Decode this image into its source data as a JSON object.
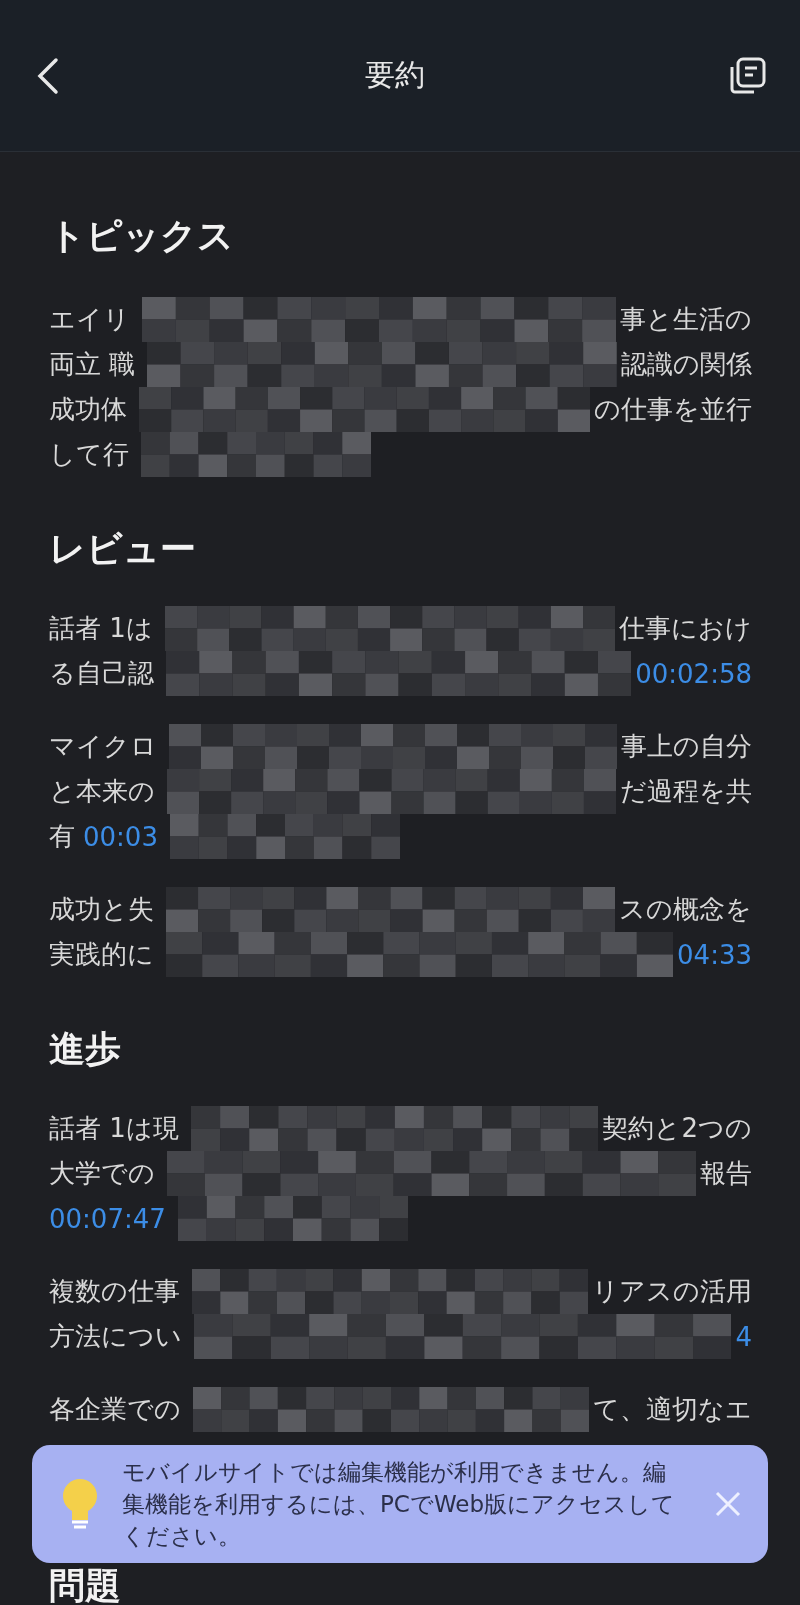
{
  "header": {
    "title": "要約"
  },
  "sections": [
    {
      "title": "トピックス",
      "paragraphs": [
        {
          "lines": [
            {
              "left": [
                {
                  "kind": "text",
                  "text": "エイリ"
                }
              ],
              "right": [
                {
                  "kind": "text",
                  "text": "事と生活の"
                }
              ]
            },
            {
              "left": [
                {
                  "kind": "text",
                  "text": "両立 職"
                }
              ],
              "right": [
                {
                  "kind": "text",
                  "text": "認識の関係"
                }
              ]
            },
            {
              "left": [
                {
                  "kind": "text",
                  "text": "成功体"
                }
              ],
              "right": [
                {
                  "kind": "text",
                  "text": "の仕事を並行"
                }
              ]
            },
            {
              "left": [
                {
                  "kind": "text",
                  "text": "して行"
                }
              ]
            }
          ]
        }
      ]
    },
    {
      "title": "レビュー",
      "paragraphs": [
        {
          "lines": [
            {
              "left": [
                {
                  "kind": "text",
                  "text": "話者 1は"
                }
              ],
              "right": [
                {
                  "kind": "text",
                  "text": "仕事におけ"
                }
              ]
            },
            {
              "left": [
                {
                  "kind": "text",
                  "text": "る自己認"
                }
              ],
              "right": [
                {
                  "kind": "timestamp",
                  "text": "00:02:58"
                }
              ]
            }
          ]
        },
        {
          "lines": [
            {
              "left": [
                {
                  "kind": "text",
                  "text": "マイクロ"
                }
              ],
              "right": [
                {
                  "kind": "text",
                  "text": "事上の自分"
                }
              ]
            },
            {
              "left": [
                {
                  "kind": "text",
                  "text": "と本来の"
                }
              ],
              "right": [
                {
                  "kind": "text",
                  "text": "だ過程を共"
                }
              ]
            },
            {
              "left": [
                {
                  "kind": "text",
                  "text": "有"
                },
                {
                  "kind": "timestamp",
                  "text": "00:03"
                }
              ]
            }
          ]
        },
        {
          "lines": [
            {
              "left": [
                {
                  "kind": "text",
                  "text": "成功と失"
                }
              ],
              "right": [
                {
                  "kind": "text",
                  "text": "スの概念を"
                }
              ]
            },
            {
              "left": [
                {
                  "kind": "text",
                  "text": "実践的に"
                }
              ],
              "right": [
                {
                  "kind": "timestamp",
                  "text": "04:33"
                }
              ]
            }
          ]
        }
      ]
    },
    {
      "title": "進歩",
      "paragraphs": [
        {
          "lines": [
            {
              "left": [
                {
                  "kind": "text",
                  "text": "話者 1は現"
                }
              ],
              "right": [
                {
                  "kind": "text",
                  "text": "契約と2つの"
                }
              ]
            },
            {
              "left": [
                {
                  "kind": "text",
                  "text": "大学での"
                }
              ],
              "right": [
                {
                  "kind": "text",
                  "text": "報告"
                }
              ]
            },
            {
              "left": [
                {
                  "kind": "timestamp",
                  "text": "00:07:47"
                }
              ]
            }
          ]
        },
        {
          "lines": [
            {
              "left": [
                {
                  "kind": "text",
                  "text": "複数の仕事"
                }
              ],
              "right": [
                {
                  "kind": "text",
                  "text": "リアスの活用"
                }
              ]
            },
            {
              "left": [
                {
                  "kind": "text",
                  "text": "方法につい"
                }
              ],
              "right": [
                {
                  "kind": "timestamp",
                  "text": "4"
                }
              ]
            }
          ]
        },
        {
          "lines": [
            {
              "left": [
                {
                  "kind": "text",
                  "text": "各企業での"
                }
              ],
              "right": [
                {
                  "kind": "text",
                  "text": "て、適切なエ"
                }
              ]
            }
          ]
        }
      ]
    },
    {
      "title": "問題"
    }
  ],
  "banner": {
    "message": "モバイルサイトでは編集機能が利用できません。編集機能を利用するには、PCでWeb版にアクセスしてください。"
  }
}
